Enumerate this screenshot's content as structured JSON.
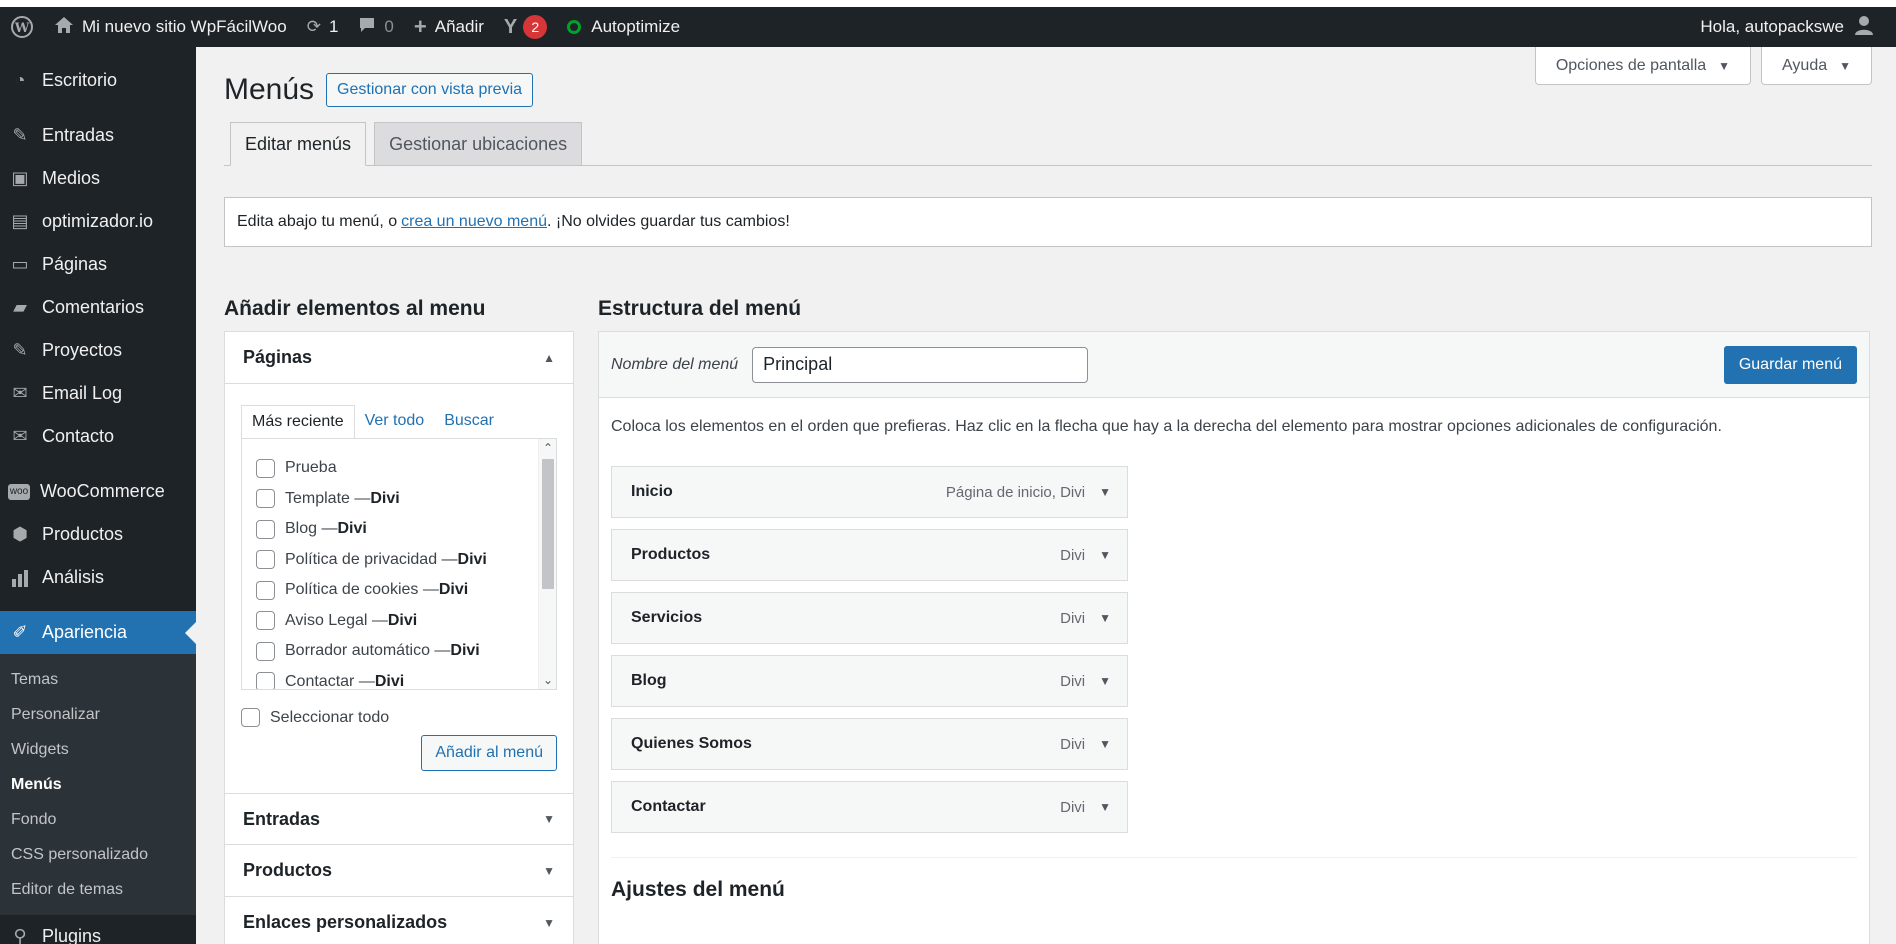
{
  "adminbar": {
    "site_name": "Mi nuevo sitio WpFácilWoo",
    "updates_count": "1",
    "comments_count": "0",
    "add_label": "Añadir",
    "yoast_count": "2",
    "autoptimize_label": "Autoptimize",
    "greeting": "Hola, autopackswe"
  },
  "sidebar": {
    "items": [
      {
        "label": "Escritorio",
        "icon": "dashboard-icon"
      },
      {
        "label": "Entradas",
        "icon": "pin-icon"
      },
      {
        "label": "Medios",
        "icon": "media-icon"
      },
      {
        "label": "optimizador.io",
        "icon": "image-icon"
      },
      {
        "label": "Páginas",
        "icon": "page-icon"
      },
      {
        "label": "Comentarios",
        "icon": "comment-icon"
      },
      {
        "label": "Proyectos",
        "icon": "pin-icon"
      },
      {
        "label": "Email Log",
        "icon": "email-icon"
      },
      {
        "label": "Contacto",
        "icon": "email-icon"
      },
      {
        "label": "WooCommerce",
        "icon": "woo-icon"
      },
      {
        "label": "Productos",
        "icon": "box-icon"
      },
      {
        "label": "Análisis",
        "icon": "chart-icon"
      },
      {
        "label": "Apariencia",
        "icon": "brush-icon"
      }
    ],
    "submenu": [
      "Temas",
      "Personalizar",
      "Widgets",
      "Menús",
      "Fondo",
      "CSS personalizado",
      "Editor de temas"
    ],
    "next_item": "Plugins"
  },
  "screen_options": {
    "options_label": "Opciones de pantalla",
    "help_label": "Ayuda"
  },
  "page": {
    "title": "Menús",
    "preview_button": "Gestionar con vista previa",
    "tabs": [
      "Editar menús",
      "Gestionar ubicaciones"
    ],
    "notice_before": "Edita abajo tu menú, o",
    "notice_link": "crea un nuevo menú",
    "notice_after": ". ¡No olvides guardar tus cambios!"
  },
  "add_items": {
    "heading": "Añadir elementos al menu",
    "pages_header": "Páginas",
    "inner_tabs": [
      "Más reciente",
      "Ver todo",
      "Buscar"
    ],
    "pages": [
      {
        "name": "Prueba",
        "suffix": ""
      },
      {
        "name": "Template — ",
        "suffix": "Divi"
      },
      {
        "name": "Blog — ",
        "suffix": "Divi"
      },
      {
        "name": "Política de privacidad — ",
        "suffix": "Divi"
      },
      {
        "name": "Política de cookies — ",
        "suffix": "Divi"
      },
      {
        "name": "Aviso Legal — ",
        "suffix": "Divi"
      },
      {
        "name": "Borrador automático — ",
        "suffix": "Divi"
      },
      {
        "name": "Contactar — ",
        "suffix": "Divi"
      }
    ],
    "select_all": "Seleccionar todo",
    "add_button": "Añadir al menú",
    "entries_header": "Entradas",
    "products_header": "Productos",
    "next_header": "Enlaces personalizados"
  },
  "structure": {
    "heading": "Estructura del menú",
    "name_label": "Nombre del menú",
    "name_value": "Principal",
    "save_button": "Guardar menú",
    "instructions": "Coloca los elementos en el orden que prefieras. Haz clic en la flecha que hay a la derecha del elemento para mostrar opciones adicionales de configuración.",
    "items": [
      {
        "title": "Inicio",
        "type": "Página de inicio, Divi"
      },
      {
        "title": "Productos",
        "type": "Divi"
      },
      {
        "title": "Servicios",
        "type": "Divi"
      },
      {
        "title": "Blog",
        "type": "Divi"
      },
      {
        "title": "Quienes Somos",
        "type": "Divi"
      },
      {
        "title": "Contactar",
        "type": "Divi"
      }
    ],
    "settings_heading": "Ajustes del menú"
  }
}
